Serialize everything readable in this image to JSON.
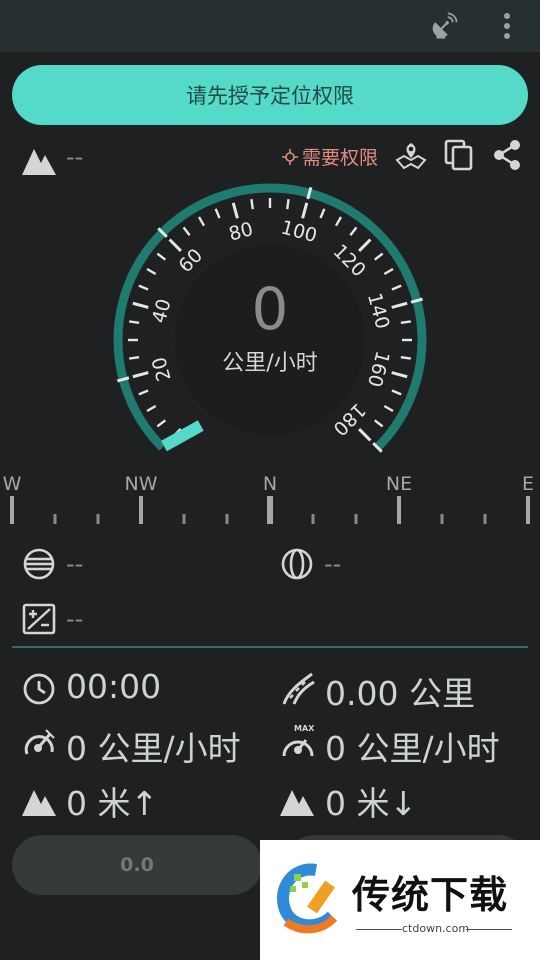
{
  "toolbar": {
    "antenna_icon": "satellite-dish-icon",
    "menu_icon": "more-vert-icon"
  },
  "permission": {
    "label": "请先授予定位权限"
  },
  "altitude_top": {
    "icon": "mountain-icon",
    "value": "--"
  },
  "location_status": {
    "label": "需要权限",
    "color": "#e08c80"
  },
  "actions": {
    "map": "map-pin-icon",
    "copy": "copy-icon",
    "share": "share-icon"
  },
  "speedometer": {
    "value": "0",
    "unit": "公里/小时",
    "ticks": [
      "20",
      "40",
      "60",
      "80",
      "100",
      "120",
      "140",
      "160",
      "180"
    ],
    "max": 180,
    "accent": "#55d9c8",
    "track": "#1f7a6f"
  },
  "compass": {
    "labels": [
      "W",
      "NW",
      "N",
      "NE",
      "E"
    ]
  },
  "coords": {
    "latitude": "--",
    "longitude": "--",
    "accuracy": "--"
  },
  "stats": {
    "time": "00:00",
    "distance": "0.00 公里",
    "avg_speed": "0 公里/小时",
    "max_speed": "0 公里/小时",
    "max_speed_badge": "MAX",
    "ascent": "0 米↑",
    "descent": "0 米↓"
  },
  "buttons": {
    "lap": "0.0"
  },
  "watermark": {
    "title": "传统下载",
    "site": "ctdown.com"
  },
  "colors": {
    "background": "#1e2021",
    "topbar": "#263031",
    "accent": "#55d9c8"
  }
}
